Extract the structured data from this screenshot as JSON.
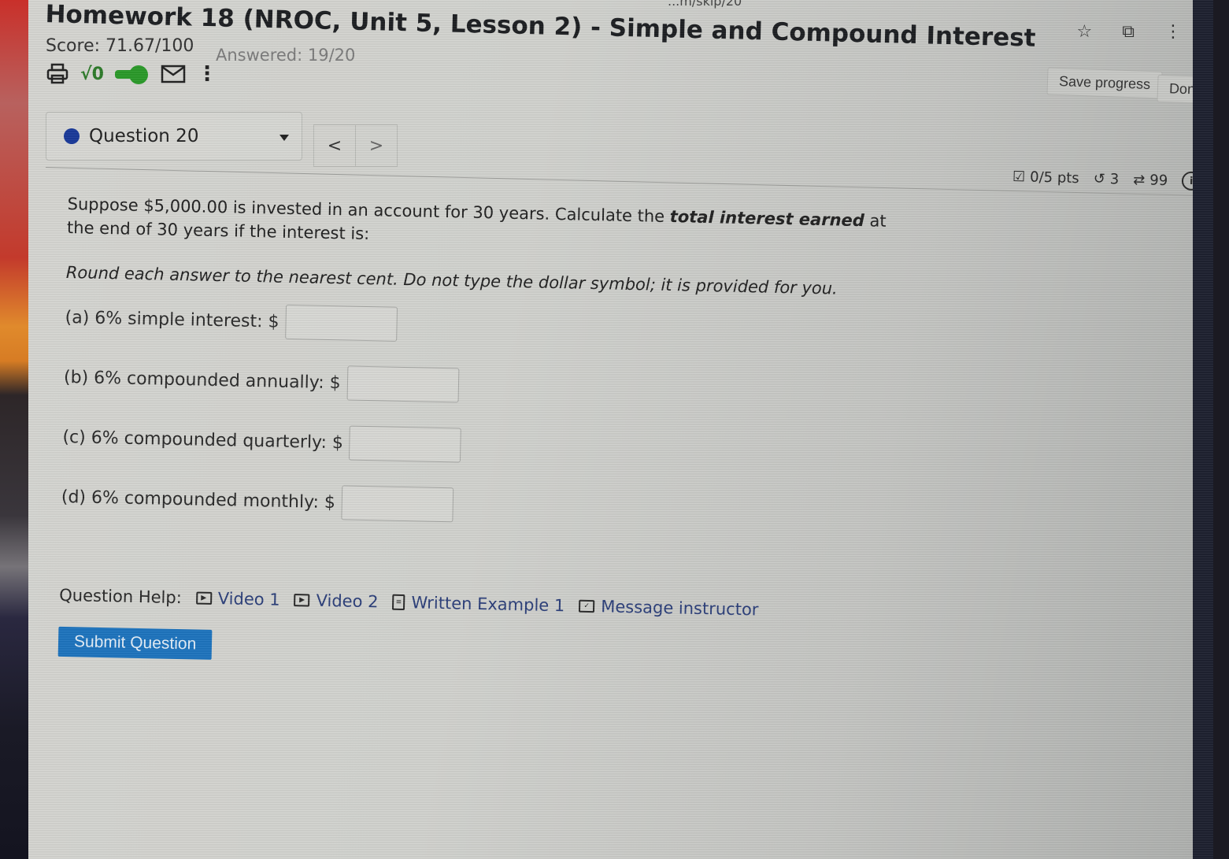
{
  "browser": {
    "url_fragment": "...m/skip/20",
    "icons": [
      "star-icon",
      "extension-icon",
      "more-vert-icon"
    ]
  },
  "header": {
    "title": "Homework 18 (NROC, Unit 5, Lesson 2) - Simple and Compound Interest",
    "score": "Score: 71.67/100",
    "answered": "Answered: 19/20",
    "toolbar_icons": [
      "print-icon",
      "math-sqrt-icon",
      "toggle-icon",
      "mail-icon",
      "more-icon"
    ],
    "sqrt_label": "√0",
    "save_label": "Save progress",
    "done_label": "Done"
  },
  "question_nav": {
    "selected": "Question 20",
    "prev_label": "<",
    "next_label": ">"
  },
  "question_meta": {
    "points": "0/5 pts",
    "retries": "3",
    "attempts": "99",
    "details_label": "Details"
  },
  "question": {
    "prompt_before": "Suppose $5,000.00 is invested in an account for 30 years. Calculate the ",
    "prompt_emphasis": "total interest earned",
    "prompt_after": " at the end of 30 years if the interest is:",
    "instructions": "Round each answer to the nearest cent. Do not type the dollar symbol; it is provided for you.",
    "parts": [
      {
        "label": "(a) 6% simple interest: $",
        "value": ""
      },
      {
        "label": "(b) 6% compounded annually: $",
        "value": ""
      },
      {
        "label": "(c) 6% compounded quarterly: $",
        "value": ""
      },
      {
        "label": "(d) 6% compounded monthly: $",
        "value": ""
      }
    ]
  },
  "help": {
    "label": "Question Help:",
    "links": [
      {
        "label": "Video 1",
        "icon": "video-icon"
      },
      {
        "label": "Video 2",
        "icon": "video-icon"
      },
      {
        "label": "Written Example 1",
        "icon": "document-icon"
      },
      {
        "label": "Message instructor",
        "icon": "mail-icon"
      }
    ]
  },
  "submit_label": "Submit Question",
  "colors": {
    "accent_blue": "#1e74be",
    "link_blue": "#2c3f7a",
    "status_dot": "#1a3a9a",
    "toggle_green": "#2b9a2a"
  }
}
